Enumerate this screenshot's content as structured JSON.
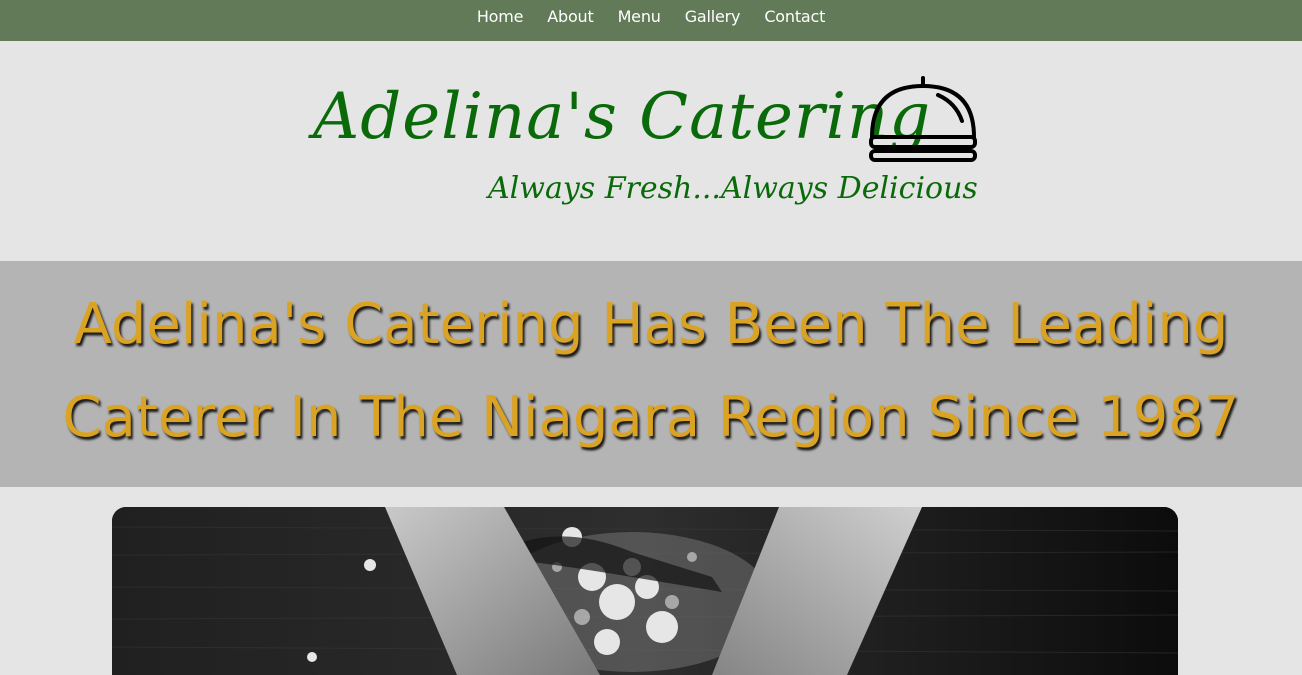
{
  "nav": {
    "items": [
      {
        "label": "Home"
      },
      {
        "label": "About"
      },
      {
        "label": "Menu"
      },
      {
        "label": "Gallery"
      },
      {
        "label": "Contact"
      }
    ]
  },
  "header": {
    "brand": "Adelina's Catering",
    "tagline": "Always Fresh...Always Delicious",
    "logo_icon": "cloche-icon"
  },
  "banner": {
    "line1": "Adelina's Catering Has Been The Leading",
    "line2": "Caterer In The Niagara Region Since 1987"
  },
  "hero_image": {
    "icon": "hands-kneading-flour-photo"
  },
  "colors": {
    "nav_bg": "#627a57",
    "brand_green": "#0a6a0a",
    "banner_bg": "#b4b4b4",
    "banner_text": "#dba323",
    "page_bg": "#e5e5e5"
  }
}
